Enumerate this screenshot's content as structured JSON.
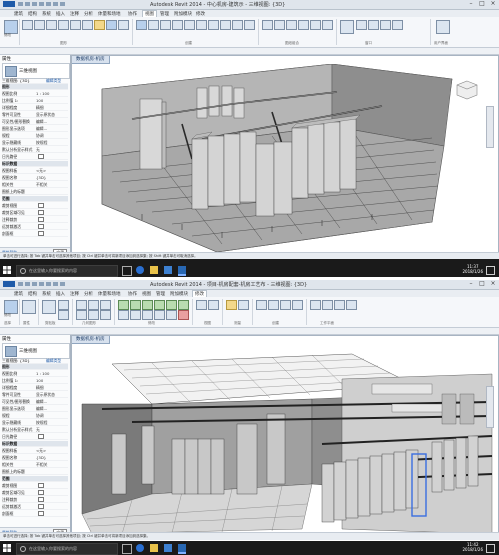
{
  "windows": [
    {
      "id": "win1",
      "title": "Autodesk Revit 2014 -  中心机房-建筑示 -  三维视图: {3D}",
      "tabs": [
        "建筑",
        "结构",
        "系统",
        "插入",
        "注释",
        "分析",
        "体量和场地",
        "协作",
        "视图",
        "管理",
        "附加模块",
        "修改"
      ],
      "active_tab": "视图",
      "ribbon_groups": [
        "图形",
        "创建",
        "图纸组合",
        "窗口",
        "用户界面"
      ],
      "ribbon_buttons": [
        "修改",
        "可见性/图形",
        "过滤器",
        "细线",
        "显示隐藏线",
        "删除隐藏线",
        "剖切面轮廓",
        "渲染",
        "Cloud渲染",
        "渲染库",
        "三维视图",
        "剖面",
        "详图索引",
        "平面视图",
        "立面",
        "绘图视图",
        "复制视图",
        "图例",
        "明细表",
        "范围框",
        "图纸",
        "视图",
        "标题栏",
        "修订",
        "拼接线",
        "视图参照",
        "切换窗口",
        "关闭隐藏对象",
        "复制",
        "层叠",
        "平铺",
        "用户界面"
      ],
      "properties": {
        "title": "属性",
        "type_name": "三维视图",
        "type_row": "三维视图: {3D}",
        "edit_type": "编辑类型",
        "rows": [
          {
            "label": "图形",
            "value": "",
            "section": true
          },
          {
            "label": "视图比例",
            "value": "1 : 100"
          },
          {
            "label": "比例值 1:",
            "value": "100"
          },
          {
            "label": "详细程度",
            "value": "精细"
          },
          {
            "label": "零件可见性",
            "value": "显示原状态"
          },
          {
            "label": "可见性/图形替换",
            "value": "编辑..."
          },
          {
            "label": "图形显示选项",
            "value": "编辑..."
          },
          {
            "label": "规程",
            "value": "协调"
          },
          {
            "label": "显示隐藏线",
            "value": "按规程"
          },
          {
            "label": "默认分析显示样式",
            "value": "无"
          },
          {
            "label": "日光路径",
            "value": "",
            "checkbox": true
          },
          {
            "label": "标识数据",
            "value": "",
            "section": true
          },
          {
            "label": "视图样板",
            "value": "<无>"
          },
          {
            "label": "视图名称",
            "value": "{3D}"
          },
          {
            "label": "相关性",
            "value": "不相关"
          },
          {
            "label": "图纸上的标题",
            "value": ""
          },
          {
            "label": "范围",
            "value": "",
            "section": true
          },
          {
            "label": "裁剪视图",
            "value": "",
            "checkbox": true
          },
          {
            "label": "裁剪区域可见",
            "value": "",
            "checkbox": true
          },
          {
            "label": "注释裁剪",
            "value": "",
            "checkbox": true
          },
          {
            "label": "远剪裁激活",
            "value": "",
            "checkbox": true
          },
          {
            "label": "剖面框",
            "value": "",
            "checkbox": true
          }
        ],
        "help_link": "属性帮助",
        "apply": "应用"
      },
      "browser_label": "项目浏览器 - 中心机房-建筑示",
      "viewport_tab": "数据机房-机房",
      "status_text": "单击可进行选择; 按 Tab 键并单击可选择其他项目; 按 Ctrl 键并单击可将新项目添加到选择集; 按 Shift 键并单击可取消选择。",
      "taskbar": {
        "search": "在这里输入你要搜索的内容",
        "time": "11:37",
        "date": "2018/1/26"
      }
    },
    {
      "id": "win2",
      "title": "Autodesk Revit 2014 -  项目-机房配套-机房工艺布 -  三维视图: {3D}",
      "tabs": [
        "建筑",
        "结构",
        "系统",
        "插入",
        "注释",
        "分析",
        "体量和场地",
        "协作",
        "视图",
        "管理",
        "附加模块",
        "修改"
      ],
      "active_tab": "修改",
      "ribbon_groups": [
        "选择",
        "属性",
        "剪贴板",
        "几何图形",
        "修改",
        "视图",
        "测量",
        "创建",
        "工作平面"
      ],
      "ribbon_buttons": [
        "修改",
        "属性",
        "粘贴",
        "剪切",
        "连接",
        "对齐",
        "偏移",
        "镜像",
        "移动",
        "复制",
        "旋转",
        "修剪",
        "拆分",
        "阵列",
        "缩放",
        "锁定",
        "删除",
        "测量",
        "创建组",
        "设置",
        "显示",
        "参照平面",
        "查看器"
      ],
      "properties": {
        "title": "属性",
        "type_name": "三维视图",
        "type_row": "三维视图: {3D}",
        "edit_type": "编辑类型",
        "rows": [
          {
            "label": "图形",
            "value": "",
            "section": true
          },
          {
            "label": "视图比例",
            "value": "1 : 100"
          },
          {
            "label": "比例值 1:",
            "value": "100"
          },
          {
            "label": "详细程度",
            "value": "精细"
          },
          {
            "label": "零件可见性",
            "value": "显示原状态"
          },
          {
            "label": "可见性/图形替换",
            "value": "编辑..."
          },
          {
            "label": "图形显示选项",
            "value": "编辑..."
          },
          {
            "label": "规程",
            "value": "协调"
          },
          {
            "label": "显示隐藏线",
            "value": "按规程"
          },
          {
            "label": "默认分析显示样式",
            "value": "无"
          },
          {
            "label": "日光路径",
            "value": "",
            "checkbox": true
          },
          {
            "label": "标识数据",
            "value": "",
            "section": true
          },
          {
            "label": "视图样板",
            "value": "<无>"
          },
          {
            "label": "视图名称",
            "value": "{3D}"
          },
          {
            "label": "相关性",
            "value": "不相关"
          },
          {
            "label": "图纸上的标题",
            "value": ""
          },
          {
            "label": "范围",
            "value": "",
            "section": true
          },
          {
            "label": "裁剪视图",
            "value": "",
            "checkbox": true
          },
          {
            "label": "裁剪区域可见",
            "value": "",
            "checkbox": true
          },
          {
            "label": "注释裁剪",
            "value": "",
            "checkbox": true
          },
          {
            "label": "远剪裁激活",
            "value": "",
            "checkbox": true
          },
          {
            "label": "剖面框",
            "value": "",
            "checkbox": true
          }
        ],
        "help_link": "属性帮助",
        "apply": "应用"
      },
      "browser_label": "项目浏览器 - 项目-机房配套-机房",
      "viewport_tab": "数据机房-机房",
      "status_text": "单击可进行选择; 按 Tab 键并单击可选择其他项目; 按 Ctrl 键并单击可将新项目添加到选择集。",
      "taskbar": {
        "search": "在这里输入你要搜索的内容",
        "time": "11:42",
        "date": "2018/1/26"
      }
    }
  ],
  "colors": {
    "accent": "#1e5aa8",
    "taskbar": "#1a1a1a",
    "ribbon": "#f5f7fa",
    "viewport_tab": "#d7e1ee",
    "selected_cabinet": "#3a6ee0"
  }
}
